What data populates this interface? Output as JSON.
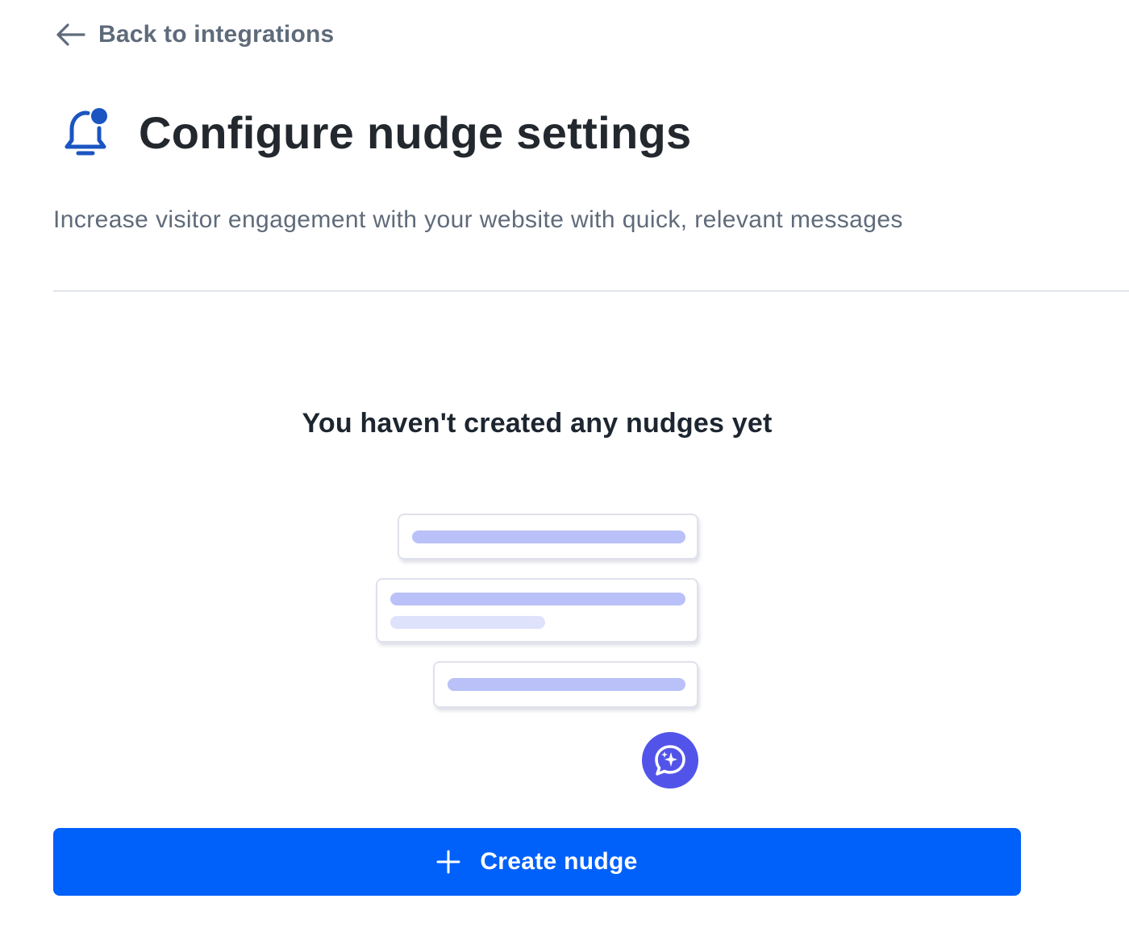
{
  "navigation": {
    "back_label": "Back to integrations",
    "back_icon": "arrow-left-icon"
  },
  "header": {
    "icon": "bell-icon",
    "title": "Configure nudge settings",
    "subtitle": "Increase visitor engagement with your website with quick, relevant messages"
  },
  "empty_state": {
    "title": "You haven't created any nudges yet",
    "illustration_badge_icon": "chat-sparkle-icon"
  },
  "actions": {
    "create_label": "Create nudge",
    "create_icon": "plus-icon"
  },
  "colors": {
    "primary": "#0060fa",
    "icon_blue": "#1b55c2",
    "badge_purple": "#5254e9",
    "placeholder_bar": "#b9c1f8",
    "placeholder_bar_light": "#dee2fb",
    "title_text": "#23282e",
    "muted_text": "#5f6b7a"
  }
}
